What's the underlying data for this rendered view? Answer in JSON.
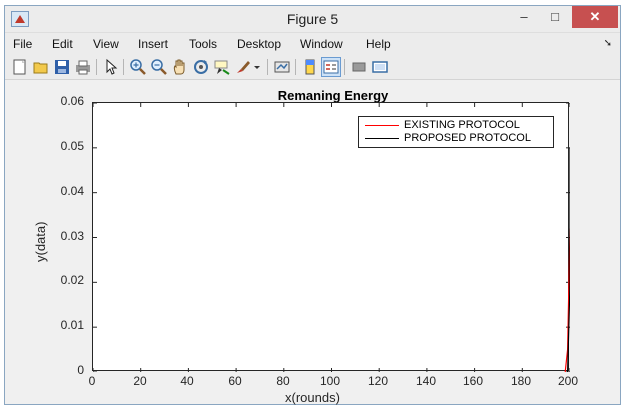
{
  "window": {
    "title": "Figure 5",
    "controls": {
      "minimize": "–",
      "maximize": "□",
      "close": "✕"
    }
  },
  "menubar": {
    "items": [
      "File",
      "Edit",
      "View",
      "Insert",
      "Tools",
      "Desktop",
      "Window",
      "Help"
    ]
  },
  "toolbar": {
    "icons": [
      "new-figure-icon",
      "open-file-icon",
      "save-icon",
      "print-icon",
      "edit-plot-arrow-icon",
      "zoom-in-icon",
      "zoom-out-icon",
      "pan-hand-icon",
      "rotate-3d-icon",
      "data-cursor-icon",
      "brush-icon",
      "link-plot-icon",
      "colorbar-icon",
      "legend-icon",
      "hide-plot-tools-icon",
      "show-plot-tools-icon"
    ]
  },
  "colors": {
    "existing": "#ff0000",
    "proposed": "#000000"
  },
  "chart_data": {
    "type": "line",
    "title": "Remaning Energy",
    "xlabel": "x(rounds)",
    "ylabel": "y(data)",
    "xlim": [
      0,
      200
    ],
    "ylim": [
      0,
      0.06
    ],
    "xticks": [
      "0",
      "20",
      "40",
      "60",
      "80",
      "100",
      "120",
      "140",
      "160",
      "180",
      "200"
    ],
    "yticks": [
      "0",
      "0.01",
      "0.02",
      "0.03",
      "0.04",
      "0.05",
      "0.06"
    ],
    "legend_position": "top-right",
    "series": [
      {
        "name": "EXISTING PROTOCOL",
        "color": "#ff0000",
        "x": [
          198,
          199,
          200
        ],
        "y": [
          0,
          0.005,
          0.032
        ]
      },
      {
        "name": "PROPOSED PROTOCOL",
        "color": "#000000",
        "x": [
          199,
          200,
          200
        ],
        "y": [
          0,
          0.02,
          0.05
        ]
      }
    ]
  }
}
